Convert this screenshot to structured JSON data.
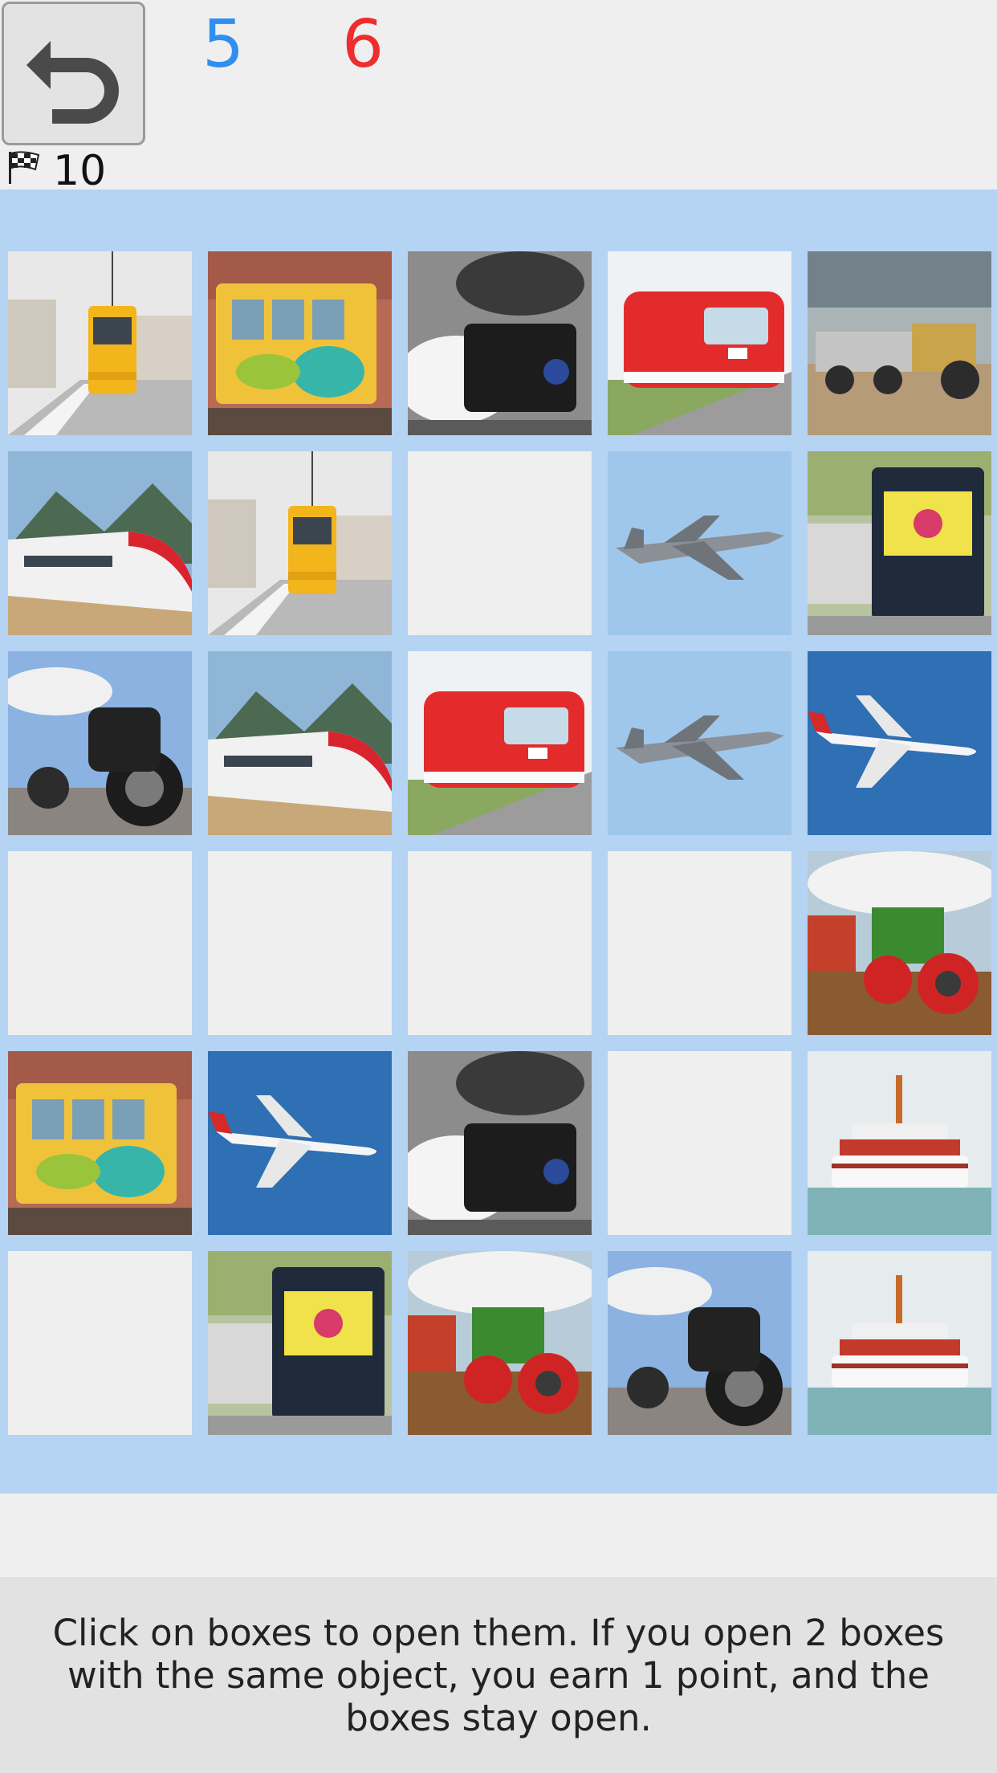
{
  "header": {
    "undo_icon": "undo-arrow-icon",
    "score_blue": "5",
    "score_red": "6",
    "colors": {
      "blue_score": "#2f8ff0",
      "red_score": "#ee2e2e",
      "board": "#b5d3f3"
    },
    "flag_icon": "checkered-flag-icon",
    "moves": "10"
  },
  "board": {
    "rows": 6,
    "cols": 5,
    "tiles": [
      [
        "tram-yellow",
        "tram-graffiti",
        "steam-locomotive",
        "red-train",
        "dump-truck"
      ],
      [
        "bullet-train",
        "tram-yellow",
        "closed",
        "fighter-jet",
        "diesel-locomotive"
      ],
      [
        "motorcycle",
        "bullet-train",
        "red-train",
        "fighter-jet",
        "airliner"
      ],
      [
        "closed",
        "closed",
        "closed",
        "closed",
        "tractor"
      ],
      [
        "tram-graffiti",
        "airliner",
        "steam-locomotive",
        "closed",
        "ferry-ship"
      ],
      [
        "closed",
        "diesel-locomotive",
        "tractor",
        "motorcycle",
        "ferry-ship"
      ]
    ]
  },
  "footer": {
    "instructions": "Click on boxes to open them. If you open 2 boxes with the same object, you earn 1 point, and the boxes stay open."
  }
}
